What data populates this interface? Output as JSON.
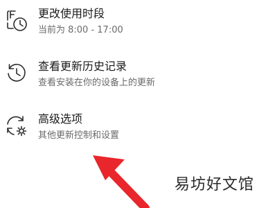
{
  "items": [
    {
      "icon": "clock-schedule-icon",
      "title": "更改使用时段",
      "subtitle": "当前为 8:00 - 17:00"
    },
    {
      "icon": "history-icon",
      "title": "查看更新历史记录",
      "subtitle": "查看安装在你的设备上的更新"
    },
    {
      "icon": "refresh-gear-icon",
      "title": "高级选项",
      "subtitle": "其他更新控制和设置"
    }
  ],
  "annotation": {
    "arrow_color": "#e8262b"
  },
  "watermark": {
    "text": "易坊好文馆"
  }
}
